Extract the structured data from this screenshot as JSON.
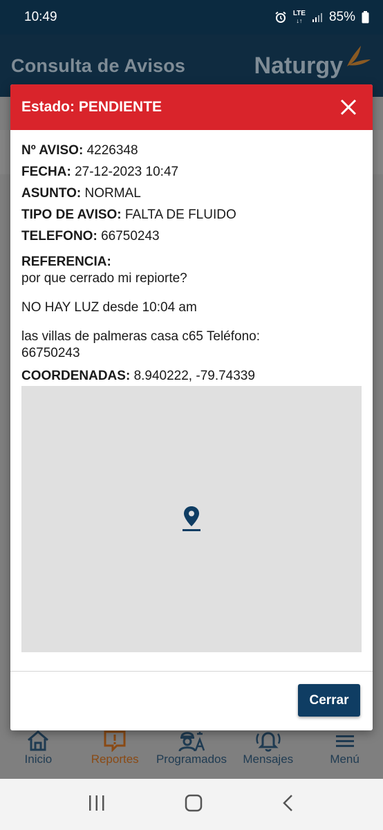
{
  "status_bar": {
    "time": "10:49",
    "network": "LTE",
    "battery": "85%"
  },
  "app_header": {
    "title": "Consulta de Avisos",
    "brand": "Naturgy"
  },
  "modal": {
    "title": "Estado: PENDIENTE",
    "fields": {
      "aviso_label": "Nº AVISO:",
      "aviso_value": "4226348",
      "fecha_label": "FECHA:",
      "fecha_value": "27-12-2023 10:47",
      "asunto_label": "ASUNTO:",
      "asunto_value": "NORMAL",
      "tipo_label": "TIPO DE AVISO:",
      "tipo_value": "FALTA DE FLUIDO",
      "telefono_label": "TELEFONO:",
      "telefono_value": "66750243",
      "referencia_label": "REFERENCIA:",
      "referencia_lines": [
        "por que cerrado mi repiorte?",
        "NO HAY LUZ  desde 10:04 am",
        "las villas de palmeras  casa c65 Teléfono: 66750243"
      ],
      "coordenadas_label": "COORDENADAS:",
      "coordenadas_value": "8.940222, -79.74339"
    },
    "close_button": "Cerrar"
  },
  "bottom_nav": {
    "items": [
      {
        "label": "Inicio",
        "icon": "home-icon"
      },
      {
        "label": "Reportes",
        "icon": "report-icon",
        "active": true
      },
      {
        "label": "Programados",
        "icon": "worker-icon"
      },
      {
        "label": "Mensajes",
        "icon": "bell-icon"
      },
      {
        "label": "Menú",
        "icon": "menu-icon"
      }
    ]
  },
  "colors": {
    "header_bg": "#0f2b40",
    "modal_header": "#d9242b",
    "button": "#0f3d63",
    "map_bg": "#e0e0e0"
  }
}
